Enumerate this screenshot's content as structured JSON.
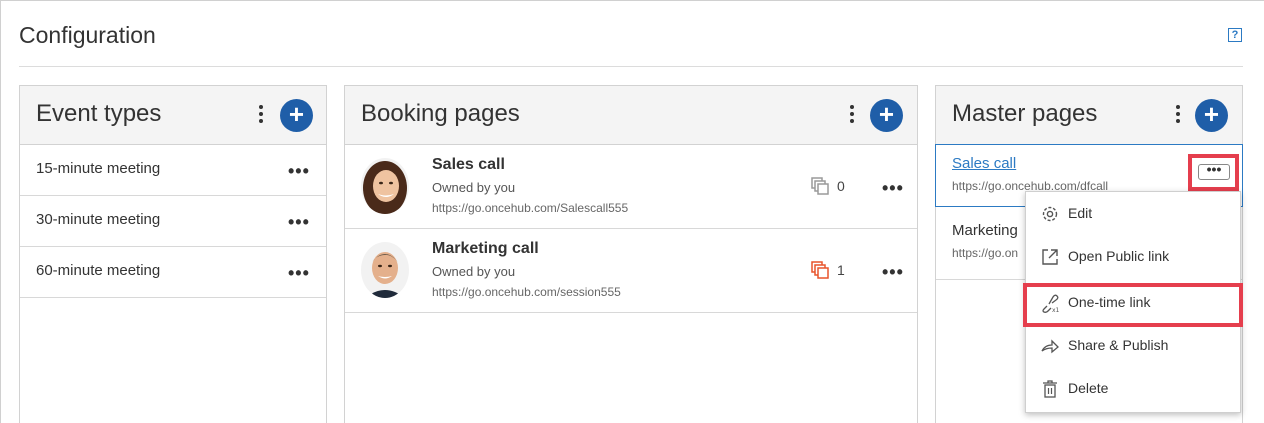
{
  "page": {
    "title": "Configuration",
    "help": "?"
  },
  "event_types": {
    "title": "Event types",
    "items": [
      {
        "label": "15-minute meeting"
      },
      {
        "label": "30-minute meeting"
      },
      {
        "label": "60-minute meeting"
      }
    ]
  },
  "booking_pages": {
    "title": "Booking pages",
    "items": [
      {
        "name": "Sales call",
        "owner": "Owned by you",
        "url": "https://go.oncehub.com/Salescall555",
        "count": "0",
        "count_color": "#9a9a9a"
      },
      {
        "name": "Marketing call",
        "owner": "Owned by you",
        "url": "https://go.oncehub.com/session555",
        "count": "1",
        "count_color": "#e8542b"
      }
    ]
  },
  "master_pages": {
    "title": "Master pages",
    "items": [
      {
        "name": "Sales call",
        "url": "https://go.oncehub.com/dfcall"
      },
      {
        "name": "Marketing",
        "url": "https://go.on"
      }
    ]
  },
  "context_menu": {
    "items": [
      {
        "label": "Edit",
        "icon": "gear-icon"
      },
      {
        "label": "Open Public link",
        "icon": "external-link-icon"
      },
      {
        "label": "One-time link",
        "icon": "one-time-link-icon"
      },
      {
        "label": "Share & Publish",
        "icon": "share-icon"
      },
      {
        "label": "Delete",
        "icon": "trash-icon"
      }
    ]
  },
  "colors": {
    "accent": "#1f5ea8",
    "link": "#2c7ac3",
    "highlight": "#e53e4d"
  }
}
